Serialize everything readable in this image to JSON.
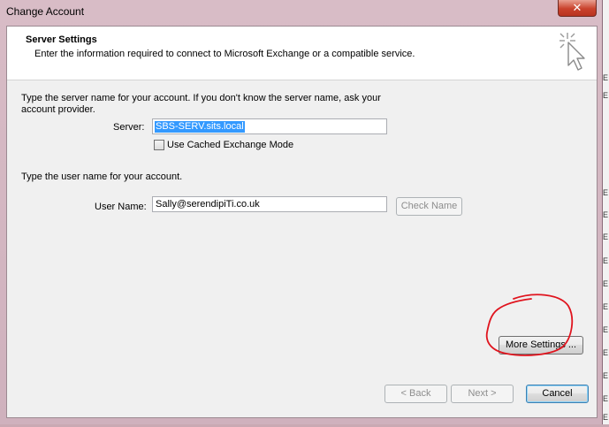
{
  "window": {
    "title": "Change Account",
    "close_glyph": "✕"
  },
  "header": {
    "title": "Server Settings",
    "subtitle": "Enter the information required to connect to Microsoft Exchange or a compatible service.",
    "icon": "wizard-cursor-icon"
  },
  "server_section": {
    "instruction_line1": "Type the server name for your account. If you don't know the server name, ask your",
    "instruction_line2": "account provider.",
    "server_label": "Server:",
    "server_value": "SBS-SERV.sits.local",
    "cached_mode_label": "Use Cached Exchange Mode",
    "cached_mode_checked": false
  },
  "user_section": {
    "instruction": "Type the user name for your account.",
    "username_label": "User Name:",
    "username_value": "Sally@serendipiTi.co.uk",
    "check_name_label": "Check Name"
  },
  "buttons": {
    "more_settings": "More Settings ...",
    "back": "< Back",
    "next": "Next >",
    "cancel": "Cancel"
  },
  "annotation": {
    "shape": "red-hand-drawn-circle",
    "color": "#e0141e"
  },
  "colors": {
    "selection": "#3399ff",
    "frame": "#d8bcc6",
    "close_button": "#c9422c"
  }
}
